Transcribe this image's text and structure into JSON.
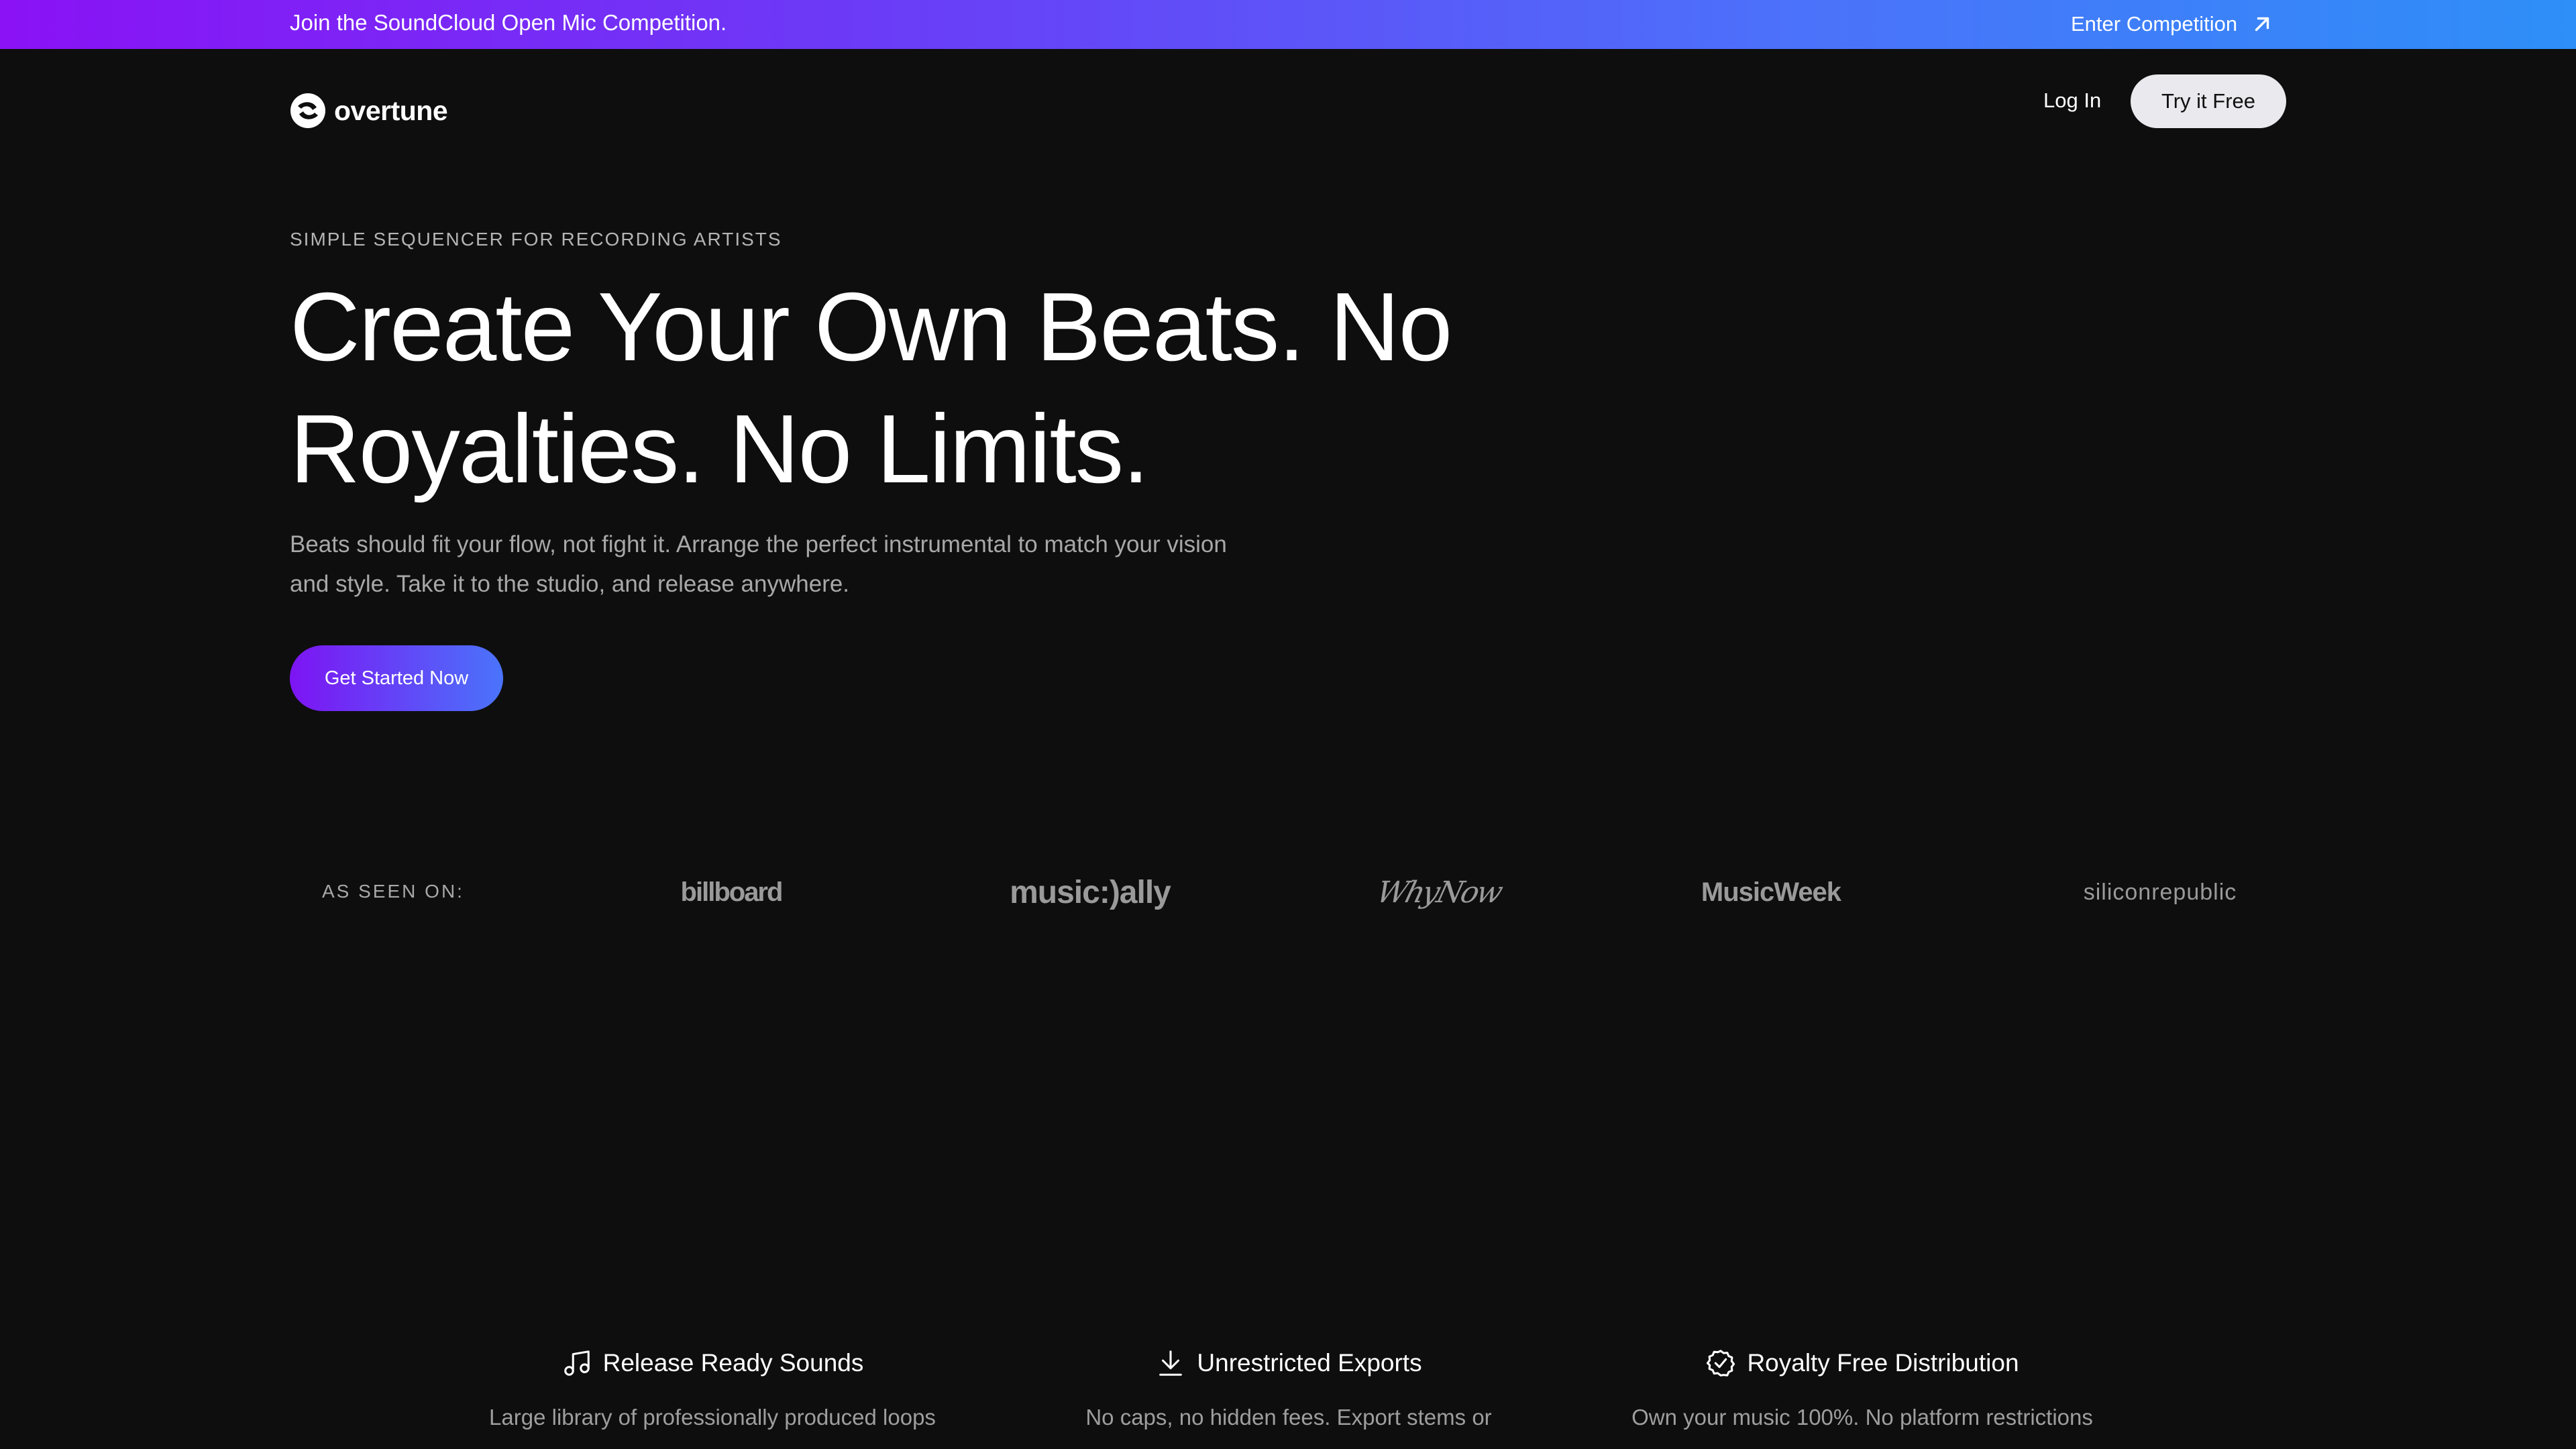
{
  "announcement": {
    "text": "Join the SoundCloud Open Mic Competition.",
    "link_label": "Enter Competition",
    "link_icon": "arrow-up-right-icon",
    "gradient_start": "#8a12f5",
    "gradient_end": "#2e8ff8"
  },
  "nav": {
    "brand": "overtune",
    "login_label": "Log In",
    "try_label": "Try it Free"
  },
  "hero": {
    "eyebrow": "SIMPLE SEQUENCER FOR RECORDING ARTISTS",
    "title": "Create Your Own Beats. No Royalties. No Limits.",
    "subtitle": "Beats should fit your flow, not fight it. Arrange the perfect instrumental to match your vision and style. Take it to the studio, and release anywhere.",
    "cta_label": "Get Started Now",
    "cta_gradient_start": "#7d14f3",
    "cta_gradient_end": "#4a74fb"
  },
  "press": {
    "label": "AS SEEN ON:",
    "logos": [
      "billboard",
      "music:)ally",
      "WhyNow",
      "MusicWeek",
      "siliconrepublic"
    ]
  },
  "features": [
    {
      "icon": "music-note-icon",
      "title": "Release Ready Sounds",
      "description": "Large library of professionally produced loops"
    },
    {
      "icon": "download-icon",
      "title": "Unrestricted Exports",
      "description": "No caps, no hidden fees. Export stems or"
    },
    {
      "icon": "check-badge-icon",
      "title": "Royalty Free Distribution",
      "description": "Own your music 100%. No platform restrictions"
    }
  ],
  "colors": {
    "background": "#0e0e0e",
    "muted_text": "#a8a8a8",
    "button_light": "#e9e9ee"
  }
}
